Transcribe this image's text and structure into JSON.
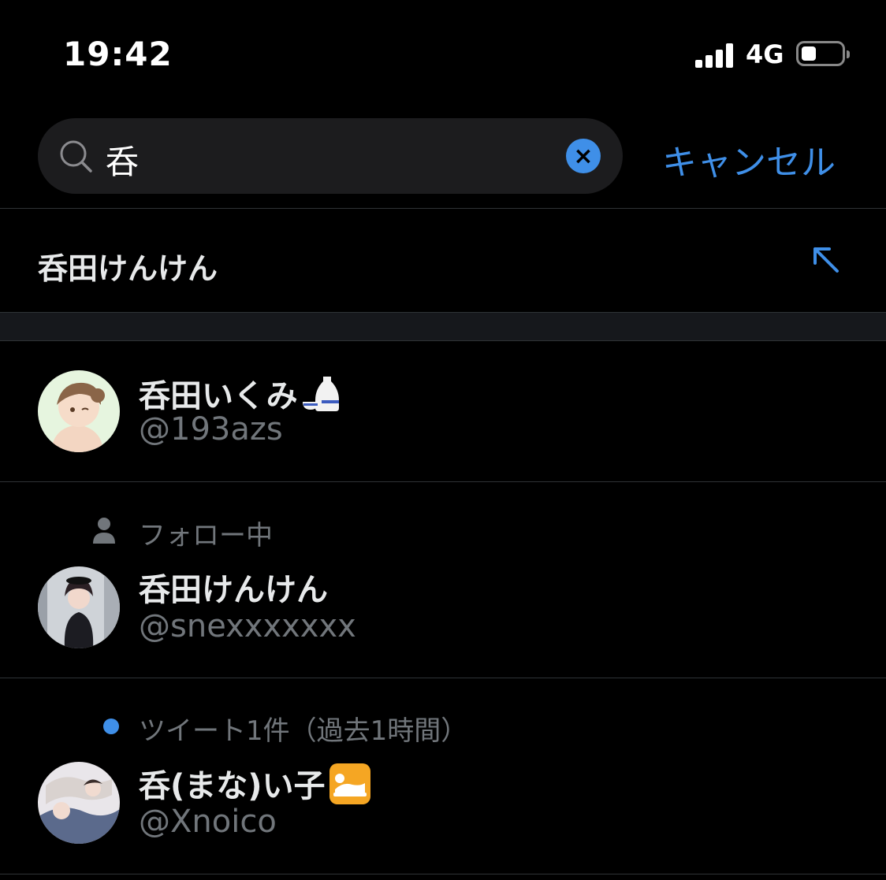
{
  "status_bar": {
    "time": "19:42",
    "network": "4G"
  },
  "search": {
    "query": "呑",
    "cancel_label": "キャンセル"
  },
  "suggestion": {
    "text": "呑田けんけん"
  },
  "results": [
    {
      "name": "呑田いくみ",
      "handle": "@193azs",
      "emoji_icon": "sake-icon",
      "context": ""
    },
    {
      "name": "呑田けんけん",
      "handle": "@snexxxxxxx",
      "context": "フォロー中",
      "context_icon": "person-icon"
    },
    {
      "name": "呑(まな)い子",
      "handle": "@Xnoico",
      "emoji_icon": "sleeping-person-icon",
      "context": "ツイート1件（過去1時間）",
      "context_icon": "blue-dot-icon"
    }
  ],
  "colors": {
    "accent": "#3f8fe8",
    "background": "#000000",
    "secondary_text": "#71767b"
  }
}
